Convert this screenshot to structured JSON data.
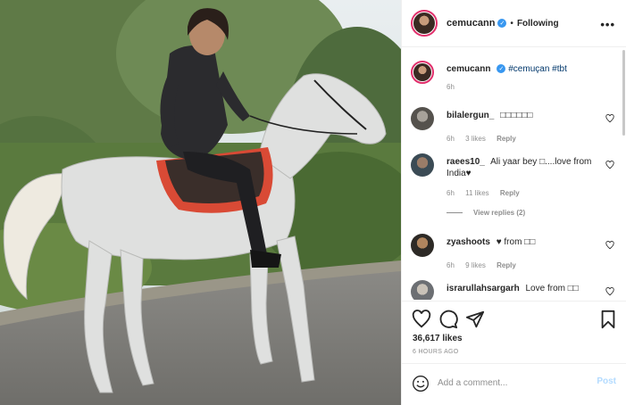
{
  "header": {
    "username": "cemucann",
    "separator": "•",
    "following_label": "Following",
    "more_label": "•••"
  },
  "caption": {
    "username": "cemucann",
    "hashtags": "#cemuçan #tbt",
    "time": "6h"
  },
  "comments": [
    {
      "username": "bilalergun_",
      "text": "□□□□□□",
      "time": "6h",
      "likes": "3 likes",
      "reply": "Reply"
    },
    {
      "username": "raees10_",
      "text": "Ali yaar bey □....love from India♥",
      "time": "6h",
      "likes": "11 likes",
      "reply": "Reply"
    },
    {
      "username": "zyashoots",
      "text": "♥ from □□",
      "time": "6h",
      "likes": "9 likes",
      "reply": "Reply"
    },
    {
      "username": "israrullahsargarh",
      "text": "Love from □□",
      "time": "",
      "likes": "",
      "reply": ""
    }
  ],
  "view_replies": "View replies (2)",
  "actions": {
    "likes_count": "36,617 likes",
    "timestamp": "6 HOURS AGO"
  },
  "composer": {
    "placeholder": "Add a comment...",
    "post_label": "Post"
  },
  "colors": {
    "accent_blue": "#3897f0",
    "post_disabled": "#b3dbff",
    "text": "#262626",
    "secondary": "#8e8e8e",
    "tag": "#00376b"
  },
  "icons": [
    "heart-icon",
    "comment-icon",
    "share-icon",
    "bookmark-icon",
    "emoji-icon",
    "verified-icon",
    "more-icon"
  ]
}
